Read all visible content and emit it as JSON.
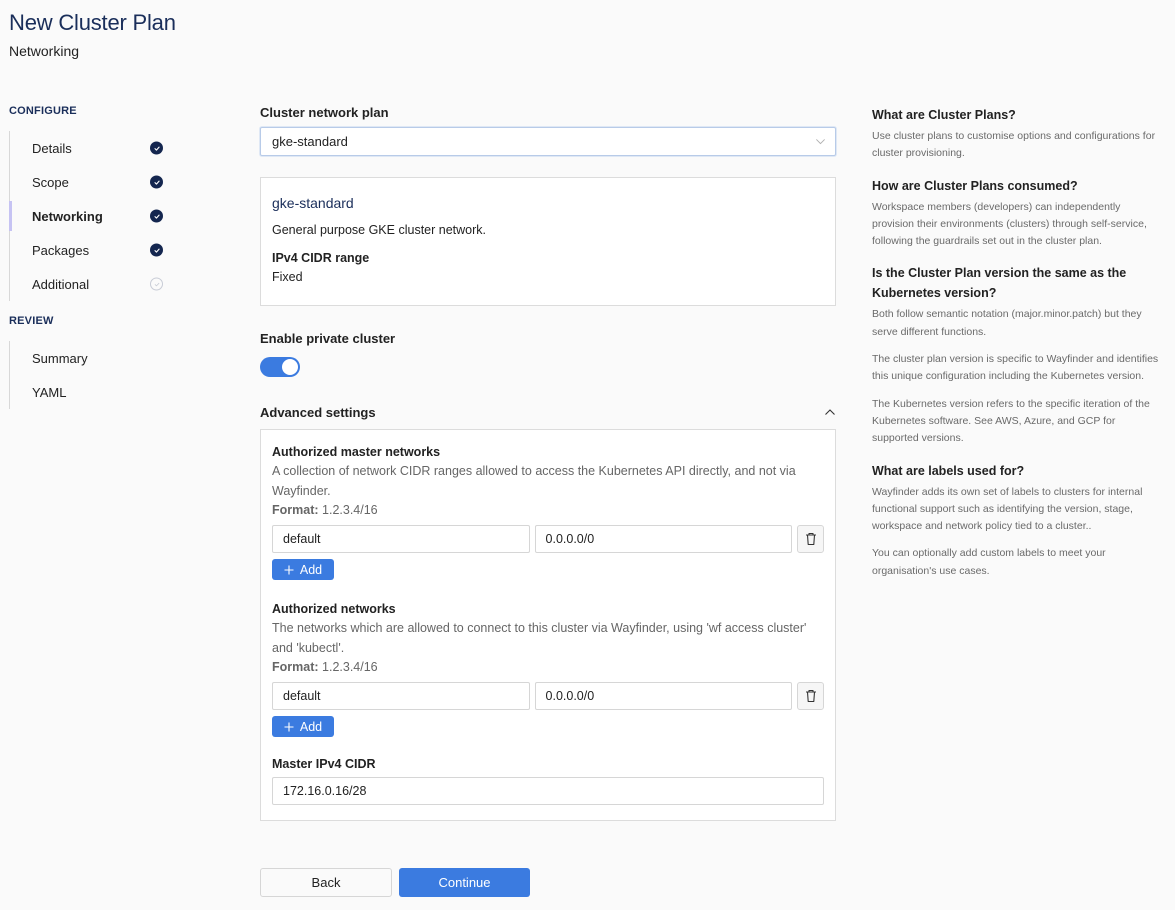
{
  "header": {
    "title": "New Cluster Plan",
    "subtitle": "Networking"
  },
  "sidebar": {
    "configure_label": "CONFIGURE",
    "configure_steps": [
      {
        "label": "Details",
        "status": "complete"
      },
      {
        "label": "Scope",
        "status": "complete"
      },
      {
        "label": "Networking",
        "status": "complete",
        "active": true
      },
      {
        "label": "Packages",
        "status": "complete"
      },
      {
        "label": "Additional",
        "status": "pending"
      }
    ],
    "review_label": "REVIEW",
    "review_steps": [
      {
        "label": "Summary"
      },
      {
        "label": "YAML"
      }
    ]
  },
  "main": {
    "network_plan_label": "Cluster network plan",
    "network_plan_value": "gke-standard",
    "plan_card": {
      "name": "gke-standard",
      "description": "General purpose GKE cluster network.",
      "cidr_label": "IPv4 CIDR range",
      "cidr_value": "Fixed"
    },
    "private_cluster_label": "Enable private cluster",
    "private_cluster_enabled": true,
    "advanced_label": "Advanced settings",
    "advanced_expanded": true,
    "authorized_master": {
      "title": "Authorized master networks",
      "description": "A collection of network CIDR ranges allowed to access the Kubernetes API directly, and not via Wayfinder.",
      "format_label": "Format:",
      "format_value": "1.2.3.4/16",
      "rows": [
        {
          "name": "default",
          "cidr": "0.0.0.0/0"
        }
      ],
      "add_label": "Add"
    },
    "authorized_networks": {
      "title": "Authorized networks",
      "description": "The networks which are allowed to connect to this cluster via Wayfinder, using 'wf access cluster' and 'kubectl'.",
      "format_label": "Format:",
      "format_value": "1.2.3.4/16",
      "rows": [
        {
          "name": "default",
          "cidr": "0.0.0.0/0"
        }
      ],
      "add_label": "Add"
    },
    "master_cidr_label": "Master IPv4 CIDR",
    "master_cidr_value": "172.16.0.16/28"
  },
  "actions": {
    "back_label": "Back",
    "continue_label": "Continue"
  },
  "help": [
    {
      "title": "What are Cluster Plans?",
      "paragraphs": [
        "Use cluster plans to customise options and configurations for cluster provisioning."
      ]
    },
    {
      "title": "How are Cluster Plans consumed?",
      "paragraphs": [
        "Workspace members (developers) can independently provision their environments (clusters) through self-service, following the guardrails set out in the cluster plan."
      ]
    },
    {
      "title": "Is the Cluster Plan version the same as the Kubernetes version?",
      "paragraphs": [
        "Both follow semantic notation (major.minor.patch) but they serve different functions.",
        "The cluster plan version is specific to Wayfinder and identifies this unique configuration including the Kubernetes version.",
        "The Kubernetes version refers to the specific iteration of the Kubernetes software. See AWS, Azure, and GCP for supported versions."
      ]
    },
    {
      "title": "What are labels used for?",
      "paragraphs": [
        "Wayfinder adds its own set of labels to clusters for internal functional support such as identifying the version, stage, workspace and network policy tied to a cluster..",
        "You can optionally add custom labels to meet your organisation's use cases."
      ]
    }
  ],
  "colors": {
    "primary": "#3b7be0",
    "navy": "#1a2e5a",
    "active_indicator": "#c6c3f3"
  }
}
